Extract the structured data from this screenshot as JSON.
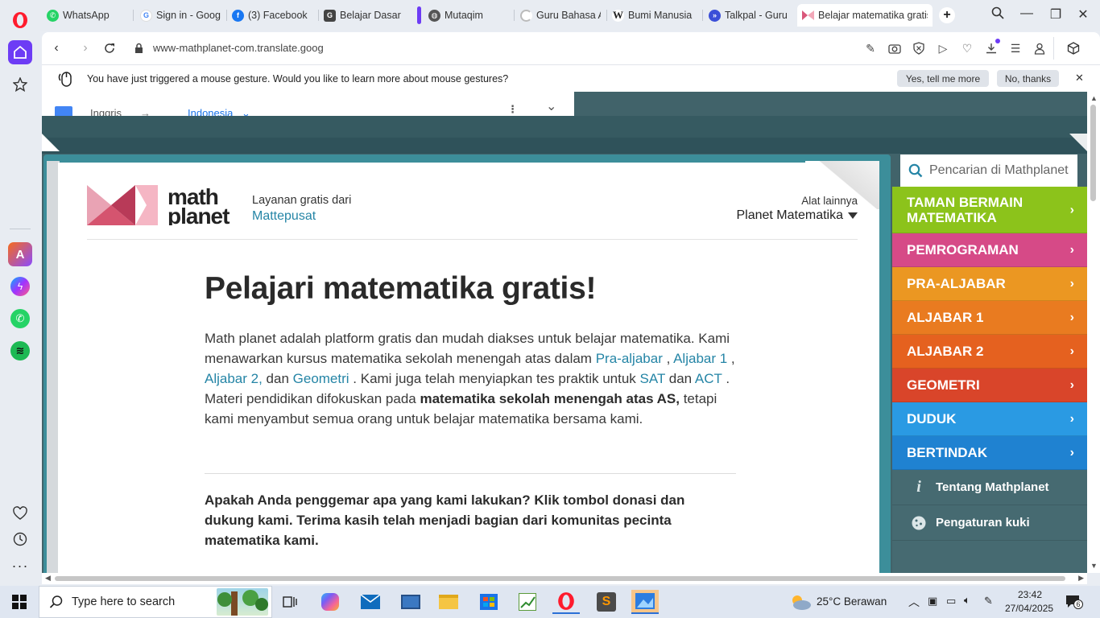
{
  "browser": {
    "tabs": [
      {
        "label": "WhatsApp",
        "icon": "whatsapp-icon",
        "color": "#25d366"
      },
      {
        "label": "Sign in - Google",
        "icon": "google-icon",
        "color": "#4285f4"
      },
      {
        "label": "(3) Facebook",
        "icon": "facebook-icon",
        "color": "#1877f2"
      },
      {
        "label": "Belajar Dasar Pe",
        "icon": "g-icon",
        "color": "#444444"
      },
      {
        "label": "Mutaqim",
        "icon": "globe-icon",
        "color": "#555555"
      },
      {
        "label": "Guru Bahasa AI",
        "icon": "loading-icon",
        "color": "#999999"
      },
      {
        "label": "Bumi Manusia (",
        "icon": "wikipedia-icon",
        "color": "#222222"
      },
      {
        "label": "Talkpal - Guru B",
        "icon": "talkpal-icon",
        "color": "#3b4fd8"
      },
      {
        "label": "Belajar matematika gratis",
        "icon": "mathplanet-icon",
        "color": "#d9577a"
      }
    ],
    "url": "www-mathplanet-com.translate.goog",
    "gesture": {
      "message": "You have just triggered a mouse gesture. Would you like to learn more about mouse gestures?",
      "yes_label": "Yes, tell me more",
      "no_label": "No, thanks"
    },
    "translate": {
      "source_lang": "Inggris",
      "arrow": "→",
      "target_lang": "Indonesia"
    }
  },
  "page": {
    "logo_text_1": "math",
    "logo_text_2": "planet",
    "tagline": "Layanan gratis dari",
    "tagline_link": "Mattepusat",
    "tools_label": "Alat lainnya",
    "tools_select": "Planet Matematika",
    "title": "Pelajari matematika gratis!",
    "intro": {
      "p1": "Math planet adalah platform gratis dan mudah diakses untuk belajar matematika. Kami menawarkan kursus matematika sekolah menengah atas dalam ",
      "link1": "Pra-aljabar",
      "sep1": " , ",
      "link2": "Aljabar 1",
      "sep2": " , ",
      "link3": "Aljabar 2,",
      "p2": " dan ",
      "link4": "Geometri",
      "p3": " . Kami juga telah menyiapkan tes praktik untuk ",
      "link5": "SAT",
      "p4": " dan ",
      "link6": "ACT",
      "p5": " . Materi pendidikan difokuskan pada ",
      "bold": "matematika sekolah menengah atas AS,",
      "p6": " tetapi kami menyambut semua orang untuk belajar matematika bersama kami."
    },
    "donate": "Apakah Anda penggemar apa yang kami lakukan? Klik tombol donasi dan dukung kami. Terima kasih telah menjadi bagian dari komunitas pecinta matematika kami.",
    "search_placeholder": "Pencarian di Mathplanet",
    "menu": [
      {
        "label": "TAMAN BERMAIN MATEMATIKA",
        "color": "#8cc31b"
      },
      {
        "label": "PEMROGRAMAN",
        "color": "#d64a87"
      },
      {
        "label": "PRA-ALJABAR",
        "color": "#eb9722"
      },
      {
        "label": "ALJABAR 1",
        "color": "#e97b20"
      },
      {
        "label": "ALJABAR 2",
        "color": "#e5611f"
      },
      {
        "label": "GEOMETRI",
        "color": "#d9452a"
      },
      {
        "label": "DUDUK",
        "color": "#2a9ae3"
      },
      {
        "label": "BERTINDAK",
        "color": "#1f82d1"
      }
    ],
    "footer_links": [
      {
        "label": "Tentang Mathplanet",
        "icon": "info-icon"
      },
      {
        "label": "Pengaturan kuki",
        "icon": "cookie-icon"
      }
    ]
  },
  "taskbar": {
    "search_placeholder": "Type here to search",
    "weather": "25°C  Berawan",
    "time": "23:42",
    "date": "27/04/2025",
    "notifications": "6"
  }
}
